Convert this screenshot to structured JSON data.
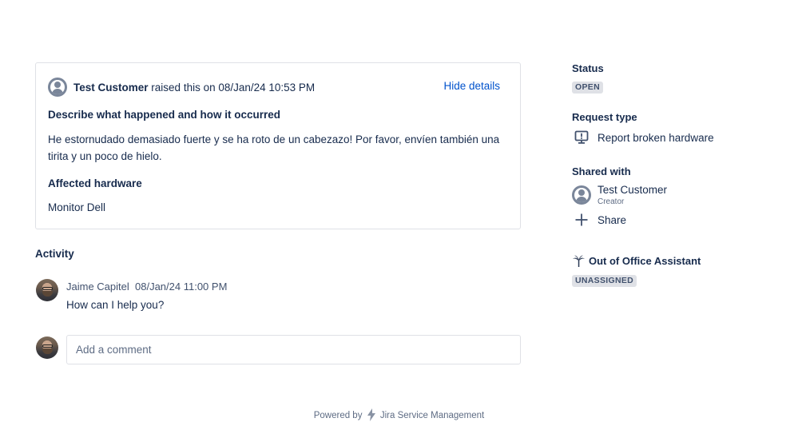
{
  "request": {
    "reporter_name": "Test Customer",
    "raised_text": "raised this on 08/Jan/24 10:53 PM",
    "hide_details": "Hide details",
    "fields": [
      {
        "label": "Describe what happened and how it occurred",
        "value": "He estornudado demasiado fuerte y se ha roto de un cabezazo! Por favor, envíen también una tirita y un poco de hielo."
      },
      {
        "label": "Affected hardware",
        "value": "Monitor Dell"
      }
    ]
  },
  "activity": {
    "title": "Activity",
    "comments": [
      {
        "author": "Jaime Capitel",
        "timestamp": "08/Jan/24 11:00 PM",
        "body": "How can I help you?"
      }
    ],
    "add_comment_placeholder": "Add a comment"
  },
  "footer": {
    "powered_by": "Powered by",
    "product": "Jira Service Management"
  },
  "sidebar": {
    "status_label": "Status",
    "status_value": "OPEN",
    "request_type_label": "Request type",
    "request_type_value": "Report broken hardware",
    "shared_with_label": "Shared with",
    "shared_user_name": "Test Customer",
    "shared_user_role": "Creator",
    "share_label": "Share",
    "ooo_label": "Out of Office Assistant",
    "ooo_value": "UNASSIGNED"
  },
  "icons": [
    "person-avatar-icon",
    "monitor-warning-icon",
    "plus-icon",
    "palm-tree-icon",
    "lightning-bolt-icon"
  ],
  "colors": {
    "link": "#0052cc",
    "text": "#172b4d",
    "lozenge_bg": "#dfe1e6",
    "border": "#dfe1e6"
  }
}
